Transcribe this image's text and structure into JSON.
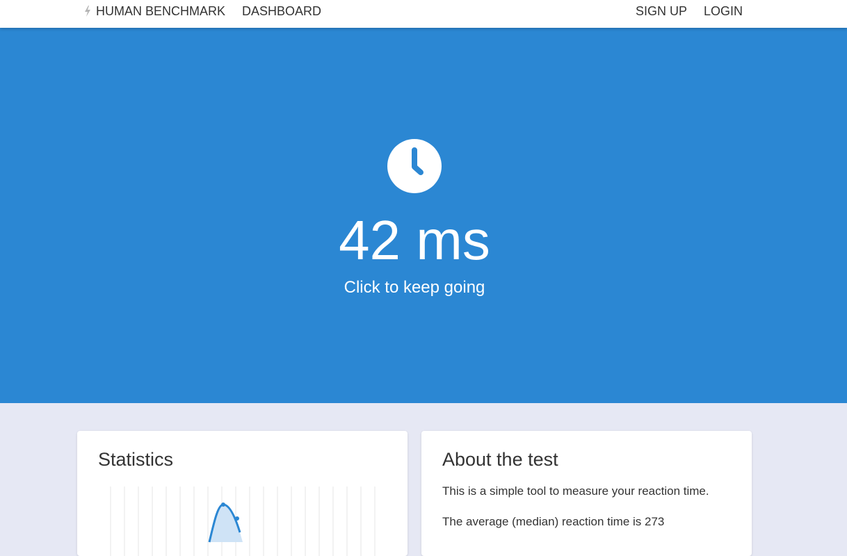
{
  "nav": {
    "brand_label": "HUMAN BENCHMARK",
    "dashboard_label": "DASHBOARD",
    "signup_label": "SIGN UP",
    "login_label": "LOGIN"
  },
  "hero": {
    "icon": "clock-icon",
    "result": "42 ms",
    "hint": "Click to keep going"
  },
  "statistics": {
    "title": "Statistics"
  },
  "about": {
    "title": "About the test",
    "paragraph1": "This is a simple tool to measure your reaction time.",
    "paragraph2": "The average (median) reaction time is 273"
  },
  "colors": {
    "accent": "#2b87d3",
    "page_background": "#e6e8f4",
    "card_background": "#ffffff",
    "text": "#333333"
  }
}
